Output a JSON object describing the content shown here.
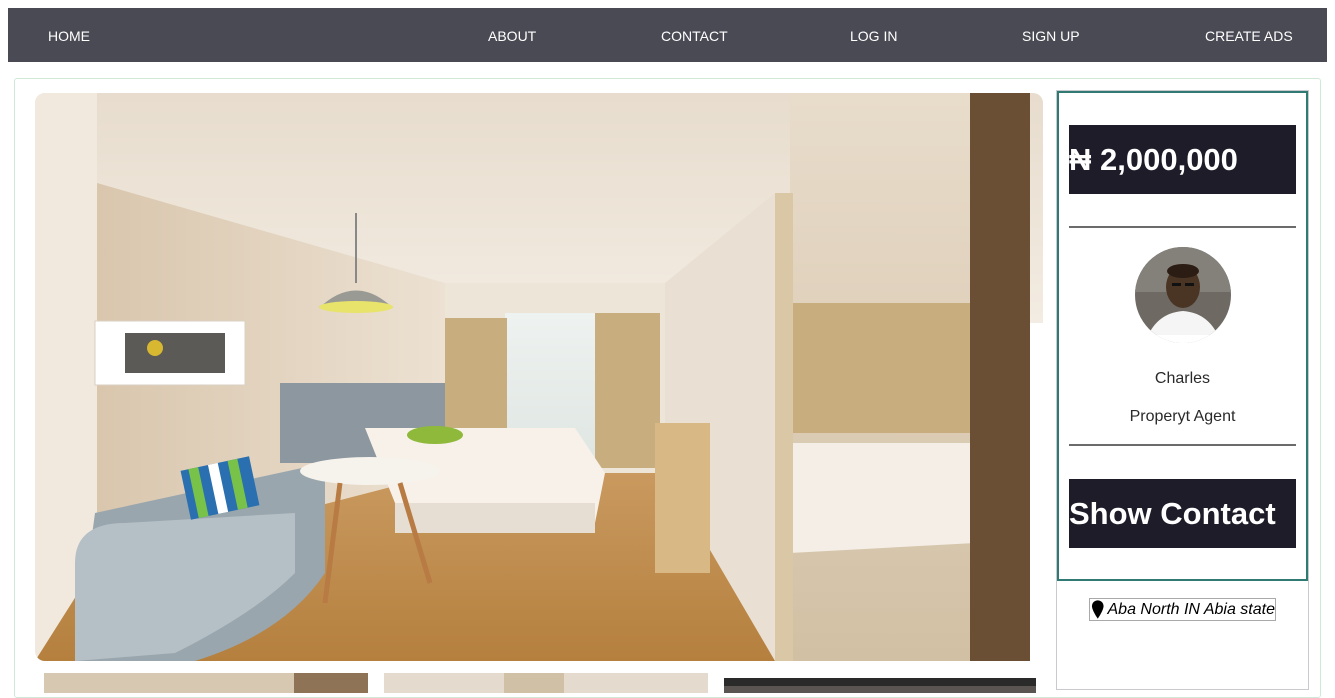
{
  "nav": {
    "home": "HOME",
    "about": "ABOUT",
    "contact": "CONTACT",
    "login": "LOG IN",
    "signup": "SIGN UP",
    "create_ads": "CREATE ADS"
  },
  "listing": {
    "price": "₦ 2,000,000",
    "location": "Aba North IN Abia state"
  },
  "agent": {
    "name": "Charles",
    "role": "Properyt Agent",
    "show_contact_label": "Show Contact"
  },
  "icons": {
    "location": "map-pin-icon"
  },
  "colors": {
    "nav_bg": "#4a4a54",
    "button_bg": "#1e1c28",
    "agent_border": "#2f7a73"
  }
}
